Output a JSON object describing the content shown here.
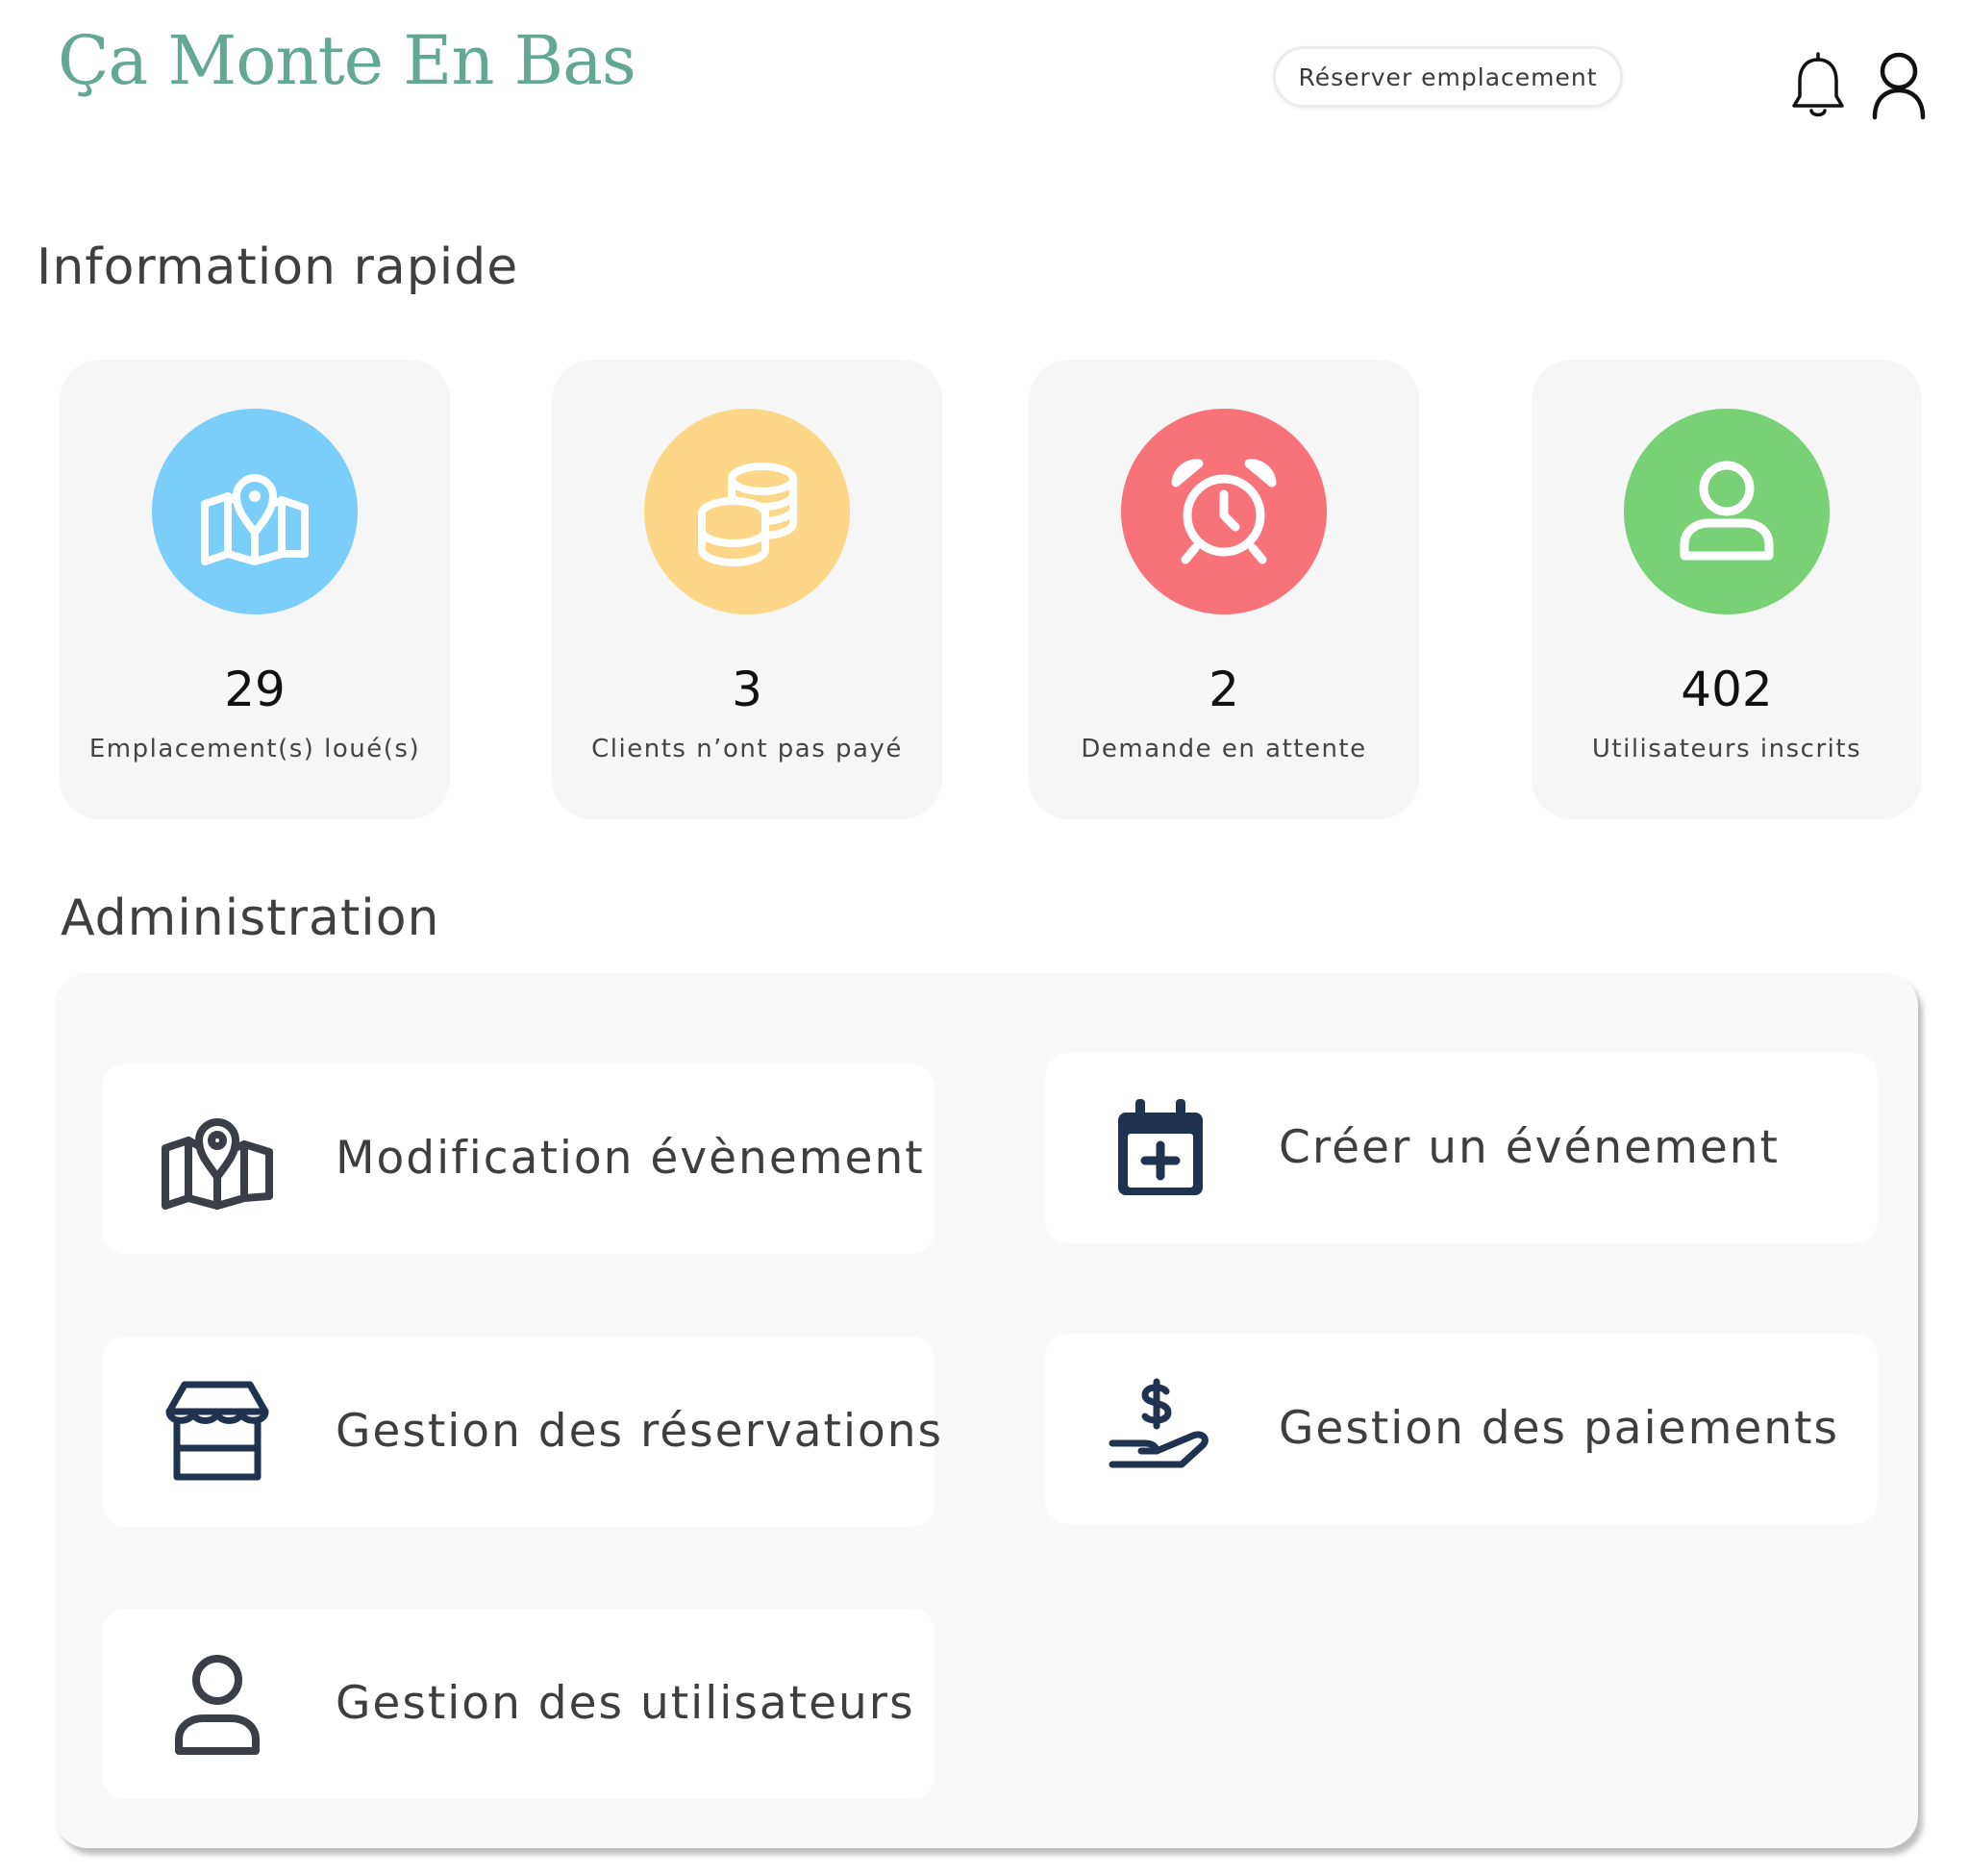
{
  "header": {
    "logo_text": "Ça Monte En Bas",
    "reserve_button_label": "Réserver emplacement",
    "icons": [
      "bell-icon",
      "user-icon"
    ]
  },
  "quick_info": {
    "title": "Information rapide",
    "cards": [
      {
        "value": "29",
        "label": "Emplacement(s) loué(s)",
        "icon": "map-pin-icon",
        "color": "#7bcdfa"
      },
      {
        "value": "3",
        "label": "Clients n’ont pas payé",
        "icon": "coins-icon",
        "color": "#fbd787"
      },
      {
        "value": "2",
        "label": "Demande en attente",
        "icon": "alarm-clock-icon",
        "color": "#f87279"
      },
      {
        "value": "402",
        "label": "Utilisateurs inscrits",
        "icon": "user-icon",
        "color": "#78d175"
      }
    ]
  },
  "administration": {
    "title": "Administration",
    "items": [
      {
        "label": "Modification évènement",
        "icon": "map-pin-icon"
      },
      {
        "label": "Créer un événement",
        "icon": "calendar-plus-icon"
      },
      {
        "label": "Gestion des réservations",
        "icon": "store-icon"
      },
      {
        "label": "Gestion des paiements",
        "icon": "dollar-hand-icon"
      },
      {
        "label": "Gestion des utilisateurs",
        "icon": "user-icon"
      }
    ]
  },
  "colors": {
    "logo": "#62a895",
    "card_background": "#f6f6f6",
    "panel_background": "#f9f9f9",
    "admin_icon_dark": "#3a3f47",
    "admin_icon_navy": "#1f3350"
  }
}
